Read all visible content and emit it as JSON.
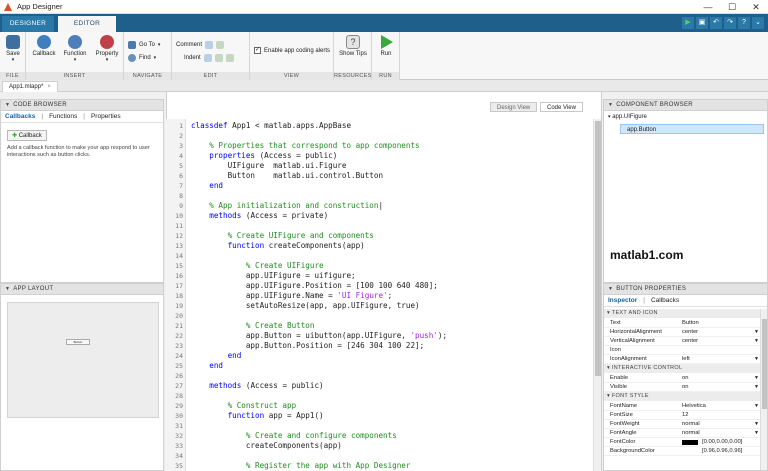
{
  "window": {
    "title": "App Designer",
    "controls": [
      "—",
      "☐",
      "✕"
    ]
  },
  "ribbon_tabs": {
    "designer": "DESIGNER",
    "editor": "EDITOR"
  },
  "ribbon": {
    "file": {
      "label": "FILE",
      "save": "Save"
    },
    "insert": {
      "label": "INSERT",
      "callback": "Callback",
      "function": "Function",
      "property": "Property"
    },
    "navigate": {
      "label": "NAVIGATE",
      "goto": "Go To",
      "find": "Find"
    },
    "edit": {
      "label": "EDIT",
      "comment": "Comment",
      "indent": "Indent"
    },
    "view": {
      "label": "VIEW",
      "alerts": "Enable app coding alerts"
    },
    "resources": {
      "label": "RESOURCES",
      "showtips": "Show Tips"
    },
    "run": {
      "label": "RUN",
      "run": "Run"
    }
  },
  "document_tab": {
    "name": "App1.mlapp*",
    "close": "×"
  },
  "code_browser": {
    "header": "CODE BROWSER",
    "tabs": [
      "Callbacks",
      "Functions",
      "Properties"
    ],
    "add_button": "Callback",
    "hint": "Add a callback function to make your app respond to user interactions such as button clicks."
  },
  "app_layout": {
    "header": "APP LAYOUT",
    "button_label": "Button"
  },
  "view_toggle": {
    "design": "Design View",
    "code": "Code View"
  },
  "code": [
    {
      "n": "1",
      "parts": [
        [
          "kw",
          "classdef"
        ],
        [
          "tx",
          " App1 < matlab.apps.AppBase"
        ]
      ]
    },
    {
      "n": "2",
      "parts": []
    },
    {
      "n": "3",
      "parts": [
        [
          "cm",
          "    % Properties that correspond to app components"
        ]
      ]
    },
    {
      "n": "4",
      "parts": [
        [
          "kw",
          "    properties"
        ],
        [
          "tx",
          " (Access = public)"
        ]
      ]
    },
    {
      "n": "5",
      "parts": [
        [
          "tx",
          "        UIFigure  matlab.ui.Figure"
        ]
      ]
    },
    {
      "n": "6",
      "parts": [
        [
          "tx",
          "        Button    matlab.ui.control.Button"
        ]
      ]
    },
    {
      "n": "7",
      "parts": [
        [
          "kw",
          "    end"
        ]
      ]
    },
    {
      "n": "8",
      "parts": []
    },
    {
      "n": "9",
      "parts": [
        [
          "cm",
          "    % App initialization and construction"
        ],
        [
          "tx",
          "|"
        ]
      ]
    },
    {
      "n": "10",
      "parts": [
        [
          "kw",
          "    methods"
        ],
        [
          "tx",
          " (Access = private)"
        ]
      ]
    },
    {
      "n": "11",
      "parts": []
    },
    {
      "n": "12",
      "parts": [
        [
          "cm",
          "        % Create UIFigure and components"
        ]
      ]
    },
    {
      "n": "13",
      "parts": [
        [
          "kw",
          "        function"
        ],
        [
          "tx",
          " createComponents(app)"
        ]
      ]
    },
    {
      "n": "14",
      "parts": []
    },
    {
      "n": "15",
      "parts": [
        [
          "cm",
          "            % Create UIFigure"
        ]
      ]
    },
    {
      "n": "16",
      "parts": [
        [
          "tx",
          "            app.UIFigure = uifigure;"
        ]
      ]
    },
    {
      "n": "17",
      "parts": [
        [
          "tx",
          "            app.UIFigure.Position = [100 100 640 480];"
        ]
      ]
    },
    {
      "n": "18",
      "parts": [
        [
          "tx",
          "            app.UIFigure.Name = "
        ],
        [
          "st",
          "'UI Figure'"
        ],
        [
          "tx",
          ";"
        ]
      ]
    },
    {
      "n": "19",
      "parts": [
        [
          "tx",
          "            setAutoResize(app, app.UIFigure, true)"
        ]
      ]
    },
    {
      "n": "20",
      "parts": []
    },
    {
      "n": "21",
      "parts": [
        [
          "cm",
          "            % Create Button"
        ]
      ]
    },
    {
      "n": "22",
      "parts": [
        [
          "tx",
          "            app.Button = uibutton(app.UIFigure, "
        ],
        [
          "st",
          "'push'"
        ],
        [
          "tx",
          ");"
        ]
      ]
    },
    {
      "n": "23",
      "parts": [
        [
          "tx",
          "            app.Button.Position = [246 304 100 22];"
        ]
      ]
    },
    {
      "n": "24",
      "parts": [
        [
          "kw",
          "        end"
        ]
      ]
    },
    {
      "n": "25",
      "parts": [
        [
          "kw",
          "    end"
        ]
      ]
    },
    {
      "n": "26",
      "parts": []
    },
    {
      "n": "27",
      "parts": [
        [
          "kw",
          "    methods"
        ],
        [
          "tx",
          " (Access = public)"
        ]
      ]
    },
    {
      "n": "28",
      "parts": []
    },
    {
      "n": "29",
      "parts": [
        [
          "cm",
          "        % Construct app"
        ]
      ]
    },
    {
      "n": "30",
      "parts": [
        [
          "kw",
          "        function"
        ],
        [
          "tx",
          " app = App1()"
        ]
      ]
    },
    {
      "n": "31",
      "parts": []
    },
    {
      "n": "32",
      "parts": [
        [
          "cm",
          "            % Create and configure components"
        ]
      ]
    },
    {
      "n": "33",
      "parts": [
        [
          "tx",
          "            createComponents(app)"
        ]
      ]
    },
    {
      "n": "34",
      "parts": []
    },
    {
      "n": "35",
      "parts": [
        [
          "cm",
          "            % Register the app with App Designer"
        ]
      ]
    }
  ],
  "component_browser": {
    "header": "COMPONENT BROWSER",
    "root": "app.UIFigure",
    "child": "app.Button"
  },
  "watermark": "matlab1.com",
  "button_properties": {
    "header": "BUTTON PROPERTIES",
    "tabs": [
      "Inspector",
      "Callbacks"
    ],
    "sections": [
      {
        "title": "TEXT AND ICON",
        "rows": [
          {
            "name": "Text",
            "value": "Button",
            "dropdown": false
          },
          {
            "name": "HorizontalAlignment",
            "value": "center",
            "dropdown": true
          },
          {
            "name": "VerticalAlignment",
            "value": "center",
            "dropdown": true
          },
          {
            "name": "Icon",
            "value": "",
            "dropdown": false
          },
          {
            "name": "IconAlignment",
            "value": "left",
            "dropdown": true
          }
        ]
      },
      {
        "title": "INTERACTIVE CONTROL",
        "rows": [
          {
            "name": "Enable",
            "value": "on",
            "dropdown": true
          },
          {
            "name": "Visible",
            "value": "on",
            "dropdown": true
          }
        ]
      },
      {
        "title": "FONT STYLE",
        "rows": [
          {
            "name": "FontName",
            "value": "Helvetica",
            "dropdown": true
          },
          {
            "name": "FontSize",
            "value": "12",
            "dropdown": false
          },
          {
            "name": "FontWeight",
            "value": "normal",
            "dropdown": true
          },
          {
            "name": "FontAngle",
            "value": "normal",
            "dropdown": true
          },
          {
            "name": "FontColor",
            "value": "[0.00,0.00,0.00]",
            "dropdown": false
          },
          {
            "name": "BackgroundColor",
            "value": "[0.96,0.96,0.96]",
            "dropdown": false
          }
        ]
      }
    ]
  },
  "colors": {
    "ribbon_tab_bar": "#1f5f8b",
    "keyword": "#0000ff",
    "comment": "#228b22",
    "string": "#a020f0",
    "selection": "#cfe6fb"
  }
}
